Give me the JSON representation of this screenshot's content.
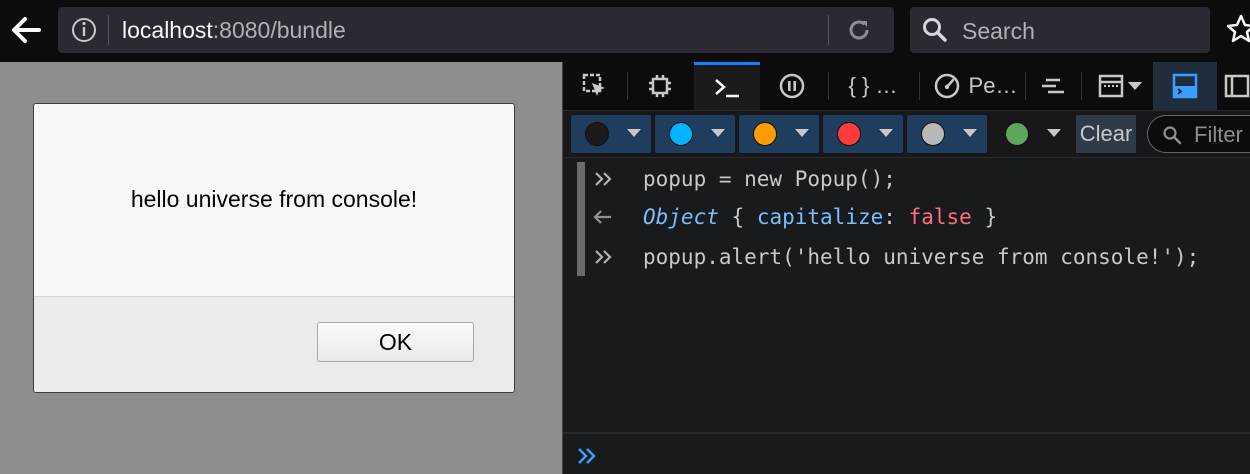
{
  "toolbar": {
    "url_host": "localhost",
    "url_rest": ":8080/bundle",
    "search_placeholder": "Search"
  },
  "dialog": {
    "message": "hello universe from console!",
    "ok_label": "OK"
  },
  "devtools": {
    "tabs": [
      {
        "name": "inspector",
        "label": ""
      },
      {
        "name": "debugger-chip",
        "label": ""
      },
      {
        "name": "console",
        "label": ""
      },
      {
        "name": "debugger",
        "label": ""
      },
      {
        "name": "style-editor",
        "label": "{ } …"
      },
      {
        "name": "performance",
        "label": "Pe…"
      }
    ],
    "filters": [
      {
        "name": "errors",
        "color": "#1b1b1d"
      },
      {
        "name": "net",
        "color": "#00b4ff"
      },
      {
        "name": "css",
        "color": "#ff9d00"
      },
      {
        "name": "js",
        "color": "#ff3b3b"
      },
      {
        "name": "security",
        "color": "#b8b8b8"
      },
      {
        "name": "logging",
        "color": "#5ea55e"
      }
    ],
    "clear_label": "Clear",
    "filter_placeholder": "Filter",
    "console_lines": [
      {
        "type": "input",
        "code": "popup = new Popup();"
      },
      {
        "type": "output",
        "obj": "Object",
        "open": "{",
        "key": "capitalize",
        "colon": ":",
        "value": "false",
        "close": "}"
      },
      {
        "type": "input",
        "code": "popup.alert('hello universe from console!');"
      }
    ]
  },
  "colors": {
    "accent": "#0a84ff",
    "console_bg": "#181a1c",
    "toolbar_bg": "#0c0c0d"
  }
}
